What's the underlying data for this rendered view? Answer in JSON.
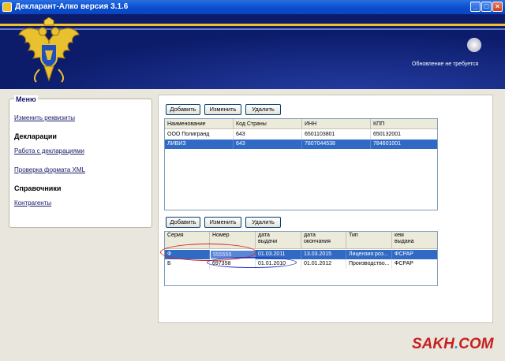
{
  "window": {
    "title": "Декларант-Алко версия 3.1.6",
    "minimize": "_",
    "maximize": "□",
    "close": "×"
  },
  "header": {
    "update_status": "Обновление не требуется"
  },
  "menu": {
    "title": "Меню",
    "edit_details": "Изменить реквизиты",
    "declarations_section": "Декларации",
    "work_with_declarations": "Работа с декларациями",
    "xml_check": "Проверка формата XML",
    "reference_section": "Справочники",
    "counterparties": "Контрагенты"
  },
  "counterparties_toolbar": {
    "add": "Добавить",
    "edit": "Изменить",
    "delete": "Удалить"
  },
  "counterparties_table": {
    "columns": [
      "Наименование",
      "Код Страны",
      "ИНН",
      "КПП"
    ],
    "rows": [
      [
        "ООО Полигранд",
        "643",
        "6501103801",
        "650132001"
      ],
      [
        "ЛИВИЗ",
        "643",
        "7807044538",
        "784601001"
      ]
    ],
    "selected_row": 1
  },
  "licenses_toolbar": {
    "add": "Добавить",
    "edit": "Изменить",
    "delete": "Удалить"
  },
  "licenses_table": {
    "columns": [
      {
        "l1": "Серия",
        "l2": ""
      },
      {
        "l1": "Номер",
        "l2": ""
      },
      {
        "l1": "дата",
        "l2": "выдачи"
      },
      {
        "l1": "дата",
        "l2": "окончания"
      },
      {
        "l1": "Тип",
        "l2": ""
      },
      {
        "l1": "кем",
        "l2": "выдана"
      }
    ],
    "rows": [
      [
        "Ф",
        "555555",
        "01.03.2011",
        "13.03.2015",
        "Лицензия роз...",
        "ФСРАР"
      ],
      [
        "Б",
        "697358",
        "01.01.2010",
        "01.01.2012",
        "Производство...",
        "ФСРАР"
      ]
    ],
    "selected_row": 0
  },
  "watermark": {
    "text_a": "SAKH",
    "text_dot": ".",
    "text_b": "COM"
  },
  "colors": {
    "selection": "#316ac5",
    "header_bg": "#0c1c6b",
    "annotation_red": "#d82020",
    "annotation_blue": "#2030c0"
  }
}
